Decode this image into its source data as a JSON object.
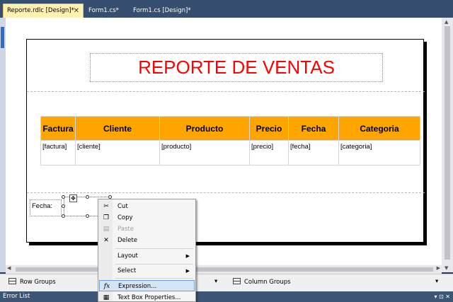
{
  "tabs": [
    {
      "label": "Reporte.rdlc [Design]*",
      "close": "✕",
      "active": true
    },
    {
      "label": "Form1.cs*",
      "active": false
    },
    {
      "label": "Form1.cs [Design]*",
      "active": false
    }
  ],
  "report": {
    "title": "REPORTE DE VENTAS",
    "title_color": "#ff0000",
    "header_color": "#ffa500",
    "columns": [
      {
        "header": "Factura",
        "field": "[factura]"
      },
      {
        "header": "Cliente",
        "field": "[cliente]"
      },
      {
        "header": "Producto",
        "field": "[producto]"
      },
      {
        "header": "Precio",
        "field": "[precio]"
      },
      {
        "header": "Fecha",
        "field": "[fecha]"
      },
      {
        "header": "Categoria",
        "field": "[categoria]"
      }
    ],
    "footer_label": "Fecha:"
  },
  "context_menu": {
    "items": [
      {
        "label": "Cut",
        "icon": "scissors-icon",
        "glyph": "✂"
      },
      {
        "label": "Copy",
        "icon": "copy-icon",
        "glyph": "❐"
      },
      {
        "label": "Paste",
        "icon": "paste-icon",
        "glyph": "▤",
        "disabled": true
      },
      {
        "label": "Delete",
        "icon": "delete-icon",
        "glyph": "✕"
      },
      {
        "label": "Layout",
        "submenu": true,
        "arrow": "▶"
      },
      {
        "label": "Select",
        "submenu": true,
        "arrow": "▶"
      },
      {
        "label": "Expression...",
        "icon": "fx-icon",
        "glyph": "fx",
        "highlighted": true
      },
      {
        "label": "Text Box Properties...",
        "icon": "properties-icon",
        "glyph": "▦"
      }
    ]
  },
  "grouping": {
    "row_groups": "Row Groups",
    "column_groups": "Column Groups",
    "dropdown_glyph": "▾"
  },
  "bottom_panel": {
    "title": "Error List",
    "buttons": "▾ ⊡ ✕"
  }
}
